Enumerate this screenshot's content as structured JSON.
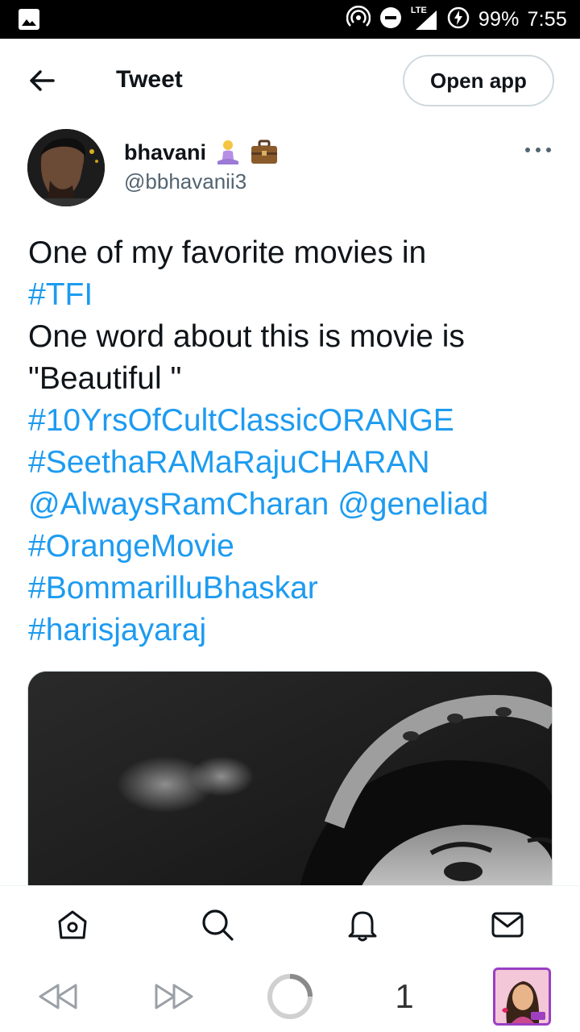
{
  "status_bar": {
    "network": "LTE",
    "battery": "99%",
    "time": "7:55"
  },
  "header": {
    "title": "Tweet",
    "open_app_label": "Open app",
    "back_icon": "arrow-left-icon"
  },
  "tweet": {
    "author_name": "bhavani",
    "author_emojis": [
      "person-in-lotus-position-emoji",
      "briefcase-emoji"
    ],
    "author_handle": "@bbhavanii3",
    "lines": [
      {
        "text": "One of my favorite movies in",
        "type": "text"
      },
      {
        "text": "#TFI",
        "type": "link"
      },
      {
        "text": "One word about this is movie is",
        "type": "text"
      },
      {
        "text": "\"Beautiful \"",
        "type": "text"
      },
      {
        "text": "#10YrsOfCultClassicORANGE",
        "type": "link"
      },
      {
        "text": "#SeethaRAMaRajuCHARAN",
        "type": "link"
      },
      {
        "text": "@AlwaysRamCharan @geneliad",
        "type": "link"
      },
      {
        "text": "#OrangeMovie",
        "type": "link"
      },
      {
        "text": "#BommarilluBhaskar",
        "type": "link"
      },
      {
        "text": "#harisjayaraj",
        "type": "link"
      }
    ],
    "media": "black-and-white-photo-woman-with-headband"
  },
  "tab_bar": {
    "items": [
      "home-icon",
      "search-icon",
      "notifications-icon",
      "messages-icon"
    ]
  },
  "browser_bar": {
    "back_icon": "rewind-icon",
    "forward_icon": "fast-forward-icon",
    "reload_icon": "loading-ring-icon",
    "tab_count": "1"
  },
  "colors": {
    "link": "#1d9bf0",
    "text": "#0f1419",
    "secondary": "#536471",
    "border": "#cfd9de"
  }
}
